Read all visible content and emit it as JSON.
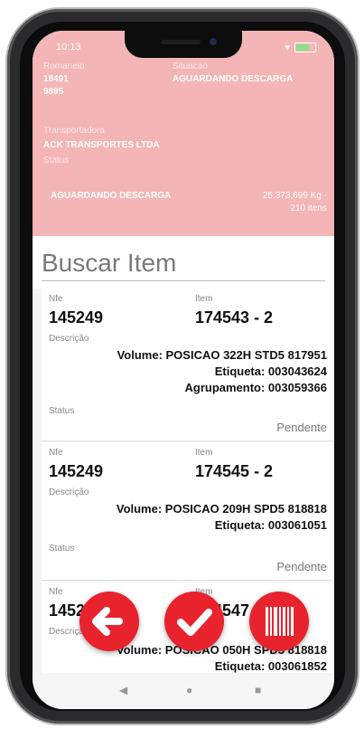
{
  "status_bar": {
    "time": "10:13"
  },
  "header": {
    "romaneio_label": "Romaneio",
    "romaneio_value_1": "18491",
    "romaneio_value_2": "9895",
    "situacao_label": "Situacao",
    "situacao_value": "AGUARDANDO DESCARGA",
    "transportadora_label": "Transportadora",
    "transportadora_value": "ACK TRANSPORTES LTDA",
    "status_label": "Status",
    "status_value": "AGUARDANDO DESCARGA",
    "weight": "25.373,699 Kg -",
    "items_count": "210 itens"
  },
  "search": {
    "title": "Buscar Item"
  },
  "labels": {
    "nfe": "Nfe",
    "item": "Item",
    "descricao": "Descrição",
    "status": "Status"
  },
  "items": [
    {
      "nfe": "145249",
      "item": "174543 - 2",
      "volume": "Volume: POSICAO 322H STD5 817951",
      "etiqueta": "Etiqueta: 003043624",
      "agrupamento": "Agrupamento: 003059366",
      "status": "Pendente"
    },
    {
      "nfe": "145249",
      "item": "174545 - 2",
      "volume": "Volume: POSICAO 209H SPD5 818818",
      "etiqueta": "Etiqueta: 003061051",
      "status": "Pendente"
    },
    {
      "nfe": "145249",
      "item": "174547 - 2",
      "volume": "Volume: POSICAO 050H SPD5 818818",
      "etiqueta": "Etiqueta: 003061852"
    }
  ],
  "actions": {
    "back_icon": "arrow-left-icon",
    "confirm_icon": "check-icon",
    "scan_icon": "barcode-icon"
  },
  "colors": {
    "header_bg": "#f3b5b5",
    "fab": "#e8232d"
  }
}
